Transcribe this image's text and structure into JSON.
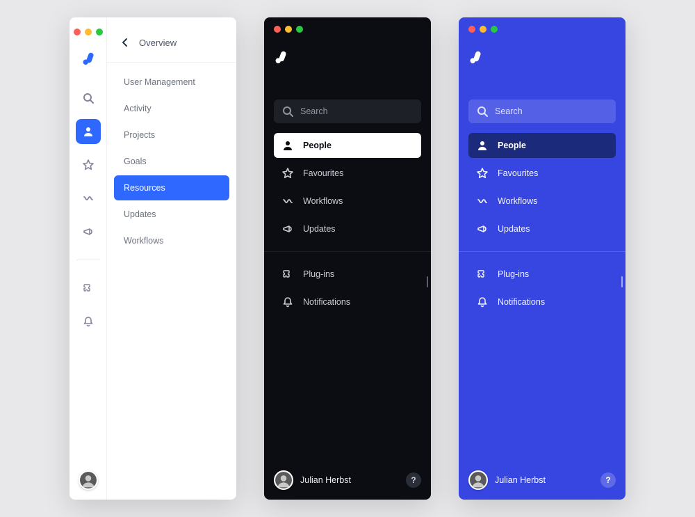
{
  "light": {
    "header_title": "Overview",
    "submenu": [
      "User Management",
      "Activity",
      "Projects",
      "Goals",
      "Resources",
      "Updates",
      "Workflows"
    ],
    "active_index": 4
  },
  "dark": {
    "search_placeholder": "Search",
    "nav_primary": [
      "People",
      "Favourites",
      "Workflows",
      "Updates"
    ],
    "nav_secondary": [
      "Plug-ins",
      "Notifications"
    ],
    "active_index": 0,
    "user_name": "Julian Herbst",
    "help_label": "?"
  },
  "blue": {
    "search_placeholder": "Search",
    "nav_primary": [
      "People",
      "Favourites",
      "Workflows",
      "Updates"
    ],
    "nav_secondary": [
      "Plug-ins",
      "Notifications"
    ],
    "active_index": 0,
    "user_name": "Julian Herbst",
    "help_label": "?"
  }
}
